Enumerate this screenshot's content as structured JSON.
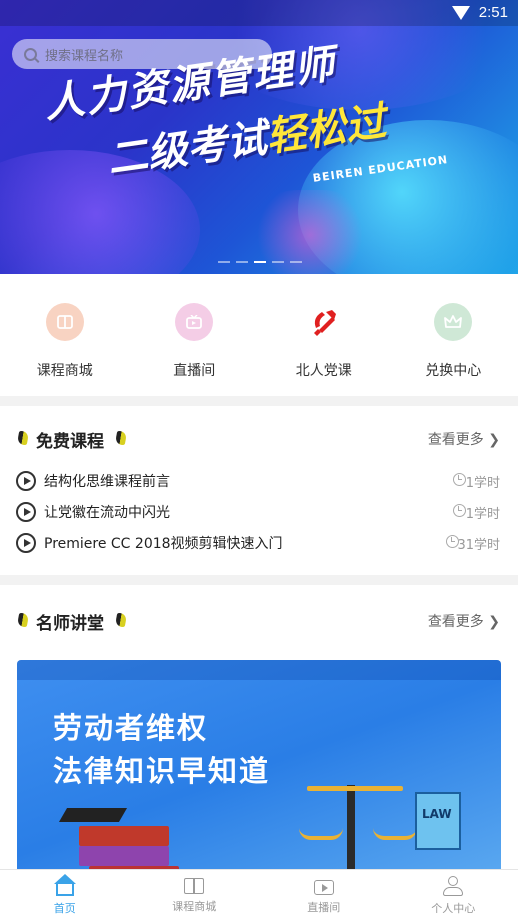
{
  "status_bar": {
    "time": "2:51",
    "wifi_icon": "wifi-icon"
  },
  "search": {
    "placeholder": "搜索课程名称",
    "icon": "search-icon"
  },
  "banner": {
    "line1": "人力资源管理师",
    "line2_a": "二级考试",
    "line2_b": "轻松过",
    "brand": "BEIREN EDUCATION",
    "slide_count": 5,
    "active_slide": 3
  },
  "quick_menu": [
    {
      "label": "课程商城",
      "icon": "book-open-icon",
      "color": "#f8d3c2"
    },
    {
      "label": "直播间",
      "icon": "tv-icon",
      "color": "#f4cde6"
    },
    {
      "label": "北人党课",
      "icon": "party-emblem-icon",
      "color": "#e02020"
    },
    {
      "label": "兑换中心",
      "icon": "crown-icon",
      "color": "#cfe8d6"
    }
  ],
  "free_courses": {
    "title": "免费课程",
    "more": "查看更多",
    "items": [
      {
        "title": "结构化思维课程前言",
        "hours": "1学时"
      },
      {
        "title": "让党徽在流动中闪光",
        "hours": "1学时"
      },
      {
        "title": "Premiere CC 2018视频剪辑快速入门",
        "hours": "31学时"
      }
    ]
  },
  "lecture_hall": {
    "title": "名师讲堂",
    "more": "查看更多",
    "banner_line1": "劳动者维权",
    "banner_line2": "法律知识早知道",
    "banner_law": "LAW"
  },
  "bottom_nav": [
    {
      "label": "首页",
      "icon": "home-icon",
      "active": true
    },
    {
      "label": "课程商城",
      "icon": "book-icon",
      "active": false
    },
    {
      "label": "直播间",
      "icon": "tv-icon",
      "active": false
    },
    {
      "label": "个人中心",
      "icon": "user-icon",
      "active": false
    }
  ],
  "colors": {
    "accent": "#3aa3e8",
    "highlight": "#ffe63a"
  }
}
